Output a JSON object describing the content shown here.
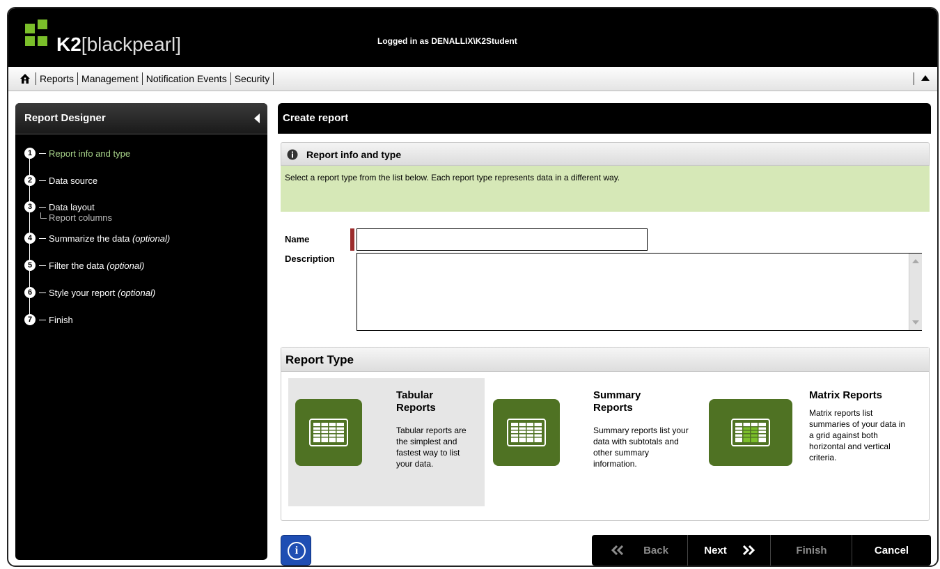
{
  "header": {
    "brand_bold": "K2",
    "brand_light": "[blackpearl]",
    "logged_prefix": "Logged in as",
    "logged_user": "DENALLIX\\K2Student"
  },
  "nav": {
    "home_icon": "home-icon",
    "items": [
      "Reports",
      "Management",
      "Notification Events",
      "Security"
    ],
    "collapse_icon": "triangle-up-icon"
  },
  "sidebar": {
    "title": "Report Designer",
    "collapse_icon": "triangle-left-icon",
    "steps": [
      {
        "num": "1",
        "label": "Report info and type",
        "optional": "",
        "active": true
      },
      {
        "num": "2",
        "label": "Data source",
        "optional": ""
      },
      {
        "num": "3",
        "label": "Data layout",
        "optional": ""
      },
      {
        "num": "4",
        "label": "Summarize the data",
        "optional": "(optional)"
      },
      {
        "num": "5",
        "label": "Filter the data",
        "optional": "(optional)"
      },
      {
        "num": "6",
        "label": "Style your report",
        "optional": "(optional)"
      },
      {
        "num": "7",
        "label": "Finish",
        "optional": ""
      }
    ],
    "substep": "Report columns"
  },
  "main": {
    "title": "Create report",
    "section_title": "Report info and type",
    "instructions": "Select a report type from the list below. Each report type represents data in a different way.",
    "name_label": "Name",
    "name_value": "",
    "description_label": "Description",
    "description_value": "",
    "report_type_title": "Report Type",
    "report_types": [
      {
        "title": "Tabular Reports",
        "description": "Tabular reports are the simplest and fastest way to list your data.",
        "selected": true
      },
      {
        "title": "Summary Reports",
        "description": "Summary reports list your data with subtotals and other summary information."
      },
      {
        "title": "Matrix Reports",
        "description": "Matrix reports list summaries of your data in a grid against both horizontal and vertical criteria."
      }
    ]
  },
  "footer": {
    "info_icon": "info-icon",
    "back_label": "Back",
    "next_label": "Next",
    "finish_label": "Finish",
    "cancel_label": "Cancel"
  },
  "colors": {
    "accent_green": "#4f7223",
    "active_step": "#a8d48a",
    "instruction_bg": "#d6e8b7",
    "required_marker": "#9b2c2c",
    "info_button": "#1f4eb3"
  }
}
